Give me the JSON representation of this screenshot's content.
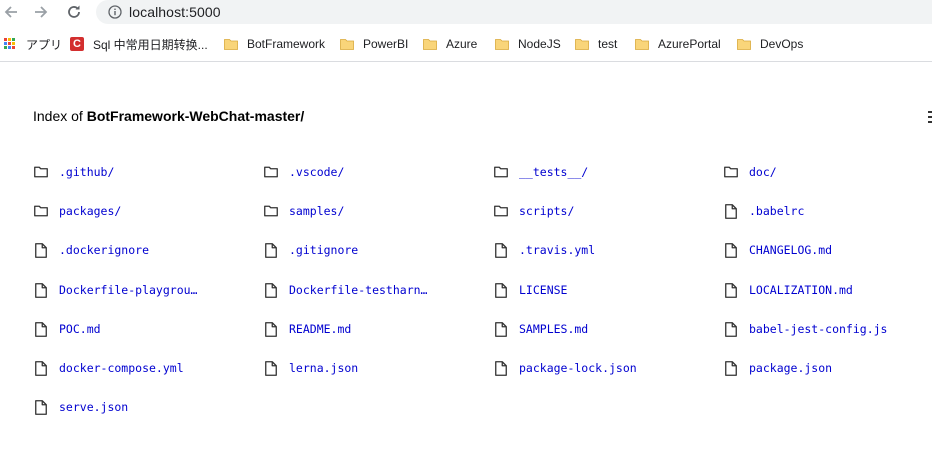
{
  "browser": {
    "url": "localhost:5000",
    "nav_icons": [
      "arrow-left-icon",
      "arrow-right-icon",
      "reload-icon",
      "info-icon"
    ]
  },
  "bookmarks": [
    {
      "label": "アプリ",
      "icon": "apps-icon"
    },
    {
      "label": "Sql 中常用日期转换...",
      "icon": "sql-icon"
    },
    {
      "label": "BotFramework",
      "icon": "folder-icon"
    },
    {
      "label": "PowerBI",
      "icon": "folder-icon"
    },
    {
      "label": "Azure",
      "icon": "folder-icon"
    },
    {
      "label": "NodeJS",
      "icon": "folder-icon"
    },
    {
      "label": "test",
      "icon": "folder-icon"
    },
    {
      "label": "AzurePortal",
      "icon": "folder-icon"
    },
    {
      "label": "DevOps",
      "icon": "folder-icon"
    }
  ],
  "page": {
    "title_prefix": "Index of ",
    "title_path": "BotFramework-WebChat-master/"
  },
  "listing": [
    {
      "name": ".github/",
      "type": "folder"
    },
    {
      "name": ".vscode/",
      "type": "folder"
    },
    {
      "name": "__tests__/",
      "type": "folder"
    },
    {
      "name": "doc/",
      "type": "folder"
    },
    {
      "name": "packages/",
      "type": "folder"
    },
    {
      "name": "samples/",
      "type": "folder"
    },
    {
      "name": "scripts/",
      "type": "folder"
    },
    {
      "name": ".babelrc",
      "type": "file"
    },
    {
      "name": ".dockerignore",
      "type": "file"
    },
    {
      "name": ".gitignore",
      "type": "file"
    },
    {
      "name": ".travis.yml",
      "type": "file"
    },
    {
      "name": "CHANGELOG.md",
      "type": "file"
    },
    {
      "name": "Dockerfile-playgrou…",
      "type": "file"
    },
    {
      "name": "Dockerfile-testharn…",
      "type": "file"
    },
    {
      "name": "LICENSE",
      "type": "file"
    },
    {
      "name": "LOCALIZATION.md",
      "type": "file"
    },
    {
      "name": "POC.md",
      "type": "file"
    },
    {
      "name": "README.md",
      "type": "file"
    },
    {
      "name": "SAMPLES.md",
      "type": "file"
    },
    {
      "name": "babel-jest-config.js",
      "type": "file"
    },
    {
      "name": "docker-compose.yml",
      "type": "file"
    },
    {
      "name": "lerna.json",
      "type": "file"
    },
    {
      "name": "package-lock.json",
      "type": "file"
    },
    {
      "name": "package.json",
      "type": "file"
    },
    {
      "name": "serve.json",
      "type": "file"
    }
  ],
  "colors": {
    "link": "#0000d0",
    "folder_bookmark": "#f9d57a",
    "omnibox_bg": "#f1f3f4"
  }
}
